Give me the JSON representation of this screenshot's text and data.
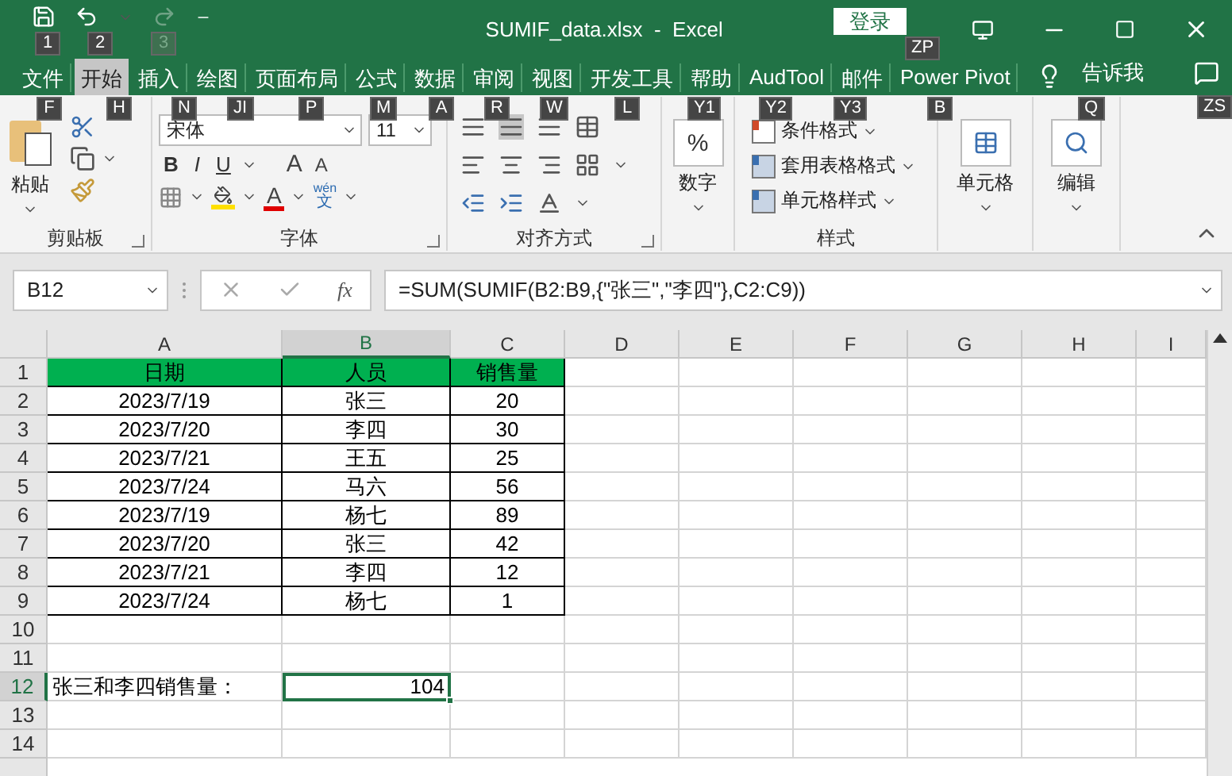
{
  "window": {
    "title": "SUMIF_data.xlsx  -  Excel",
    "login": "登录"
  },
  "tabs": [
    {
      "label": "文件",
      "selected": false
    },
    {
      "label": "开始",
      "selected": true
    },
    {
      "label": "插入",
      "selected": false
    },
    {
      "label": "绘图",
      "selected": false
    },
    {
      "label": "页面布局",
      "selected": false
    },
    {
      "label": "公式",
      "selected": false
    },
    {
      "label": "数据",
      "selected": false
    },
    {
      "label": "审阅",
      "selected": false
    },
    {
      "label": "视图",
      "selected": false
    },
    {
      "label": "开发工具",
      "selected": false
    },
    {
      "label": "帮助",
      "selected": false
    },
    {
      "label": "AudTool",
      "selected": false
    },
    {
      "label": "邮件",
      "selected": false
    },
    {
      "label": "Power Pivot",
      "selected": false
    }
  ],
  "tell_me": "告诉我",
  "keytips": [
    {
      "label": "1",
      "disabled": false
    },
    {
      "label": "2",
      "disabled": false
    },
    {
      "label": "3",
      "disabled": true
    },
    {
      "label": "ZP",
      "disabled": false
    },
    {
      "label": "F",
      "disabled": false
    },
    {
      "label": "H",
      "disabled": false
    },
    {
      "label": "N",
      "disabled": false
    },
    {
      "label": "JI",
      "disabled": false
    },
    {
      "label": "P",
      "disabled": false
    },
    {
      "label": "M",
      "disabled": false
    },
    {
      "label": "A",
      "disabled": false
    },
    {
      "label": "R",
      "disabled": false
    },
    {
      "label": "W",
      "disabled": false
    },
    {
      "label": "L",
      "disabled": false
    },
    {
      "label": "Y1",
      "disabled": false
    },
    {
      "label": "Y2",
      "disabled": false
    },
    {
      "label": "Y3",
      "disabled": false
    },
    {
      "label": "B",
      "disabled": false
    },
    {
      "label": "Q",
      "disabled": false
    },
    {
      "label": "ZS",
      "disabled": false
    }
  ],
  "ribbon": {
    "clipboard": {
      "paste": "粘贴",
      "label": "剪贴板"
    },
    "font": {
      "font_name": "宋体",
      "font_size": "11",
      "label": "字体",
      "format_buttons": [
        {
          "label": "B",
          "kind": "bold"
        },
        {
          "label": "I",
          "kind": "italic"
        },
        {
          "label": "U",
          "kind": "underline"
        }
      ],
      "grow": "A",
      "shrink": "A",
      "font_color": "A",
      "phonetic": [
        "wén",
        "文"
      ]
    },
    "alignment": {
      "label": "对齐方式"
    },
    "number": {
      "symbol": "%",
      "label": "数字"
    },
    "styles": {
      "items": [
        "条件格式",
        "套用表格格式",
        "单元格样式"
      ],
      "label": "样式"
    },
    "cells": {
      "label": "单元格"
    },
    "editing": {
      "label": "编辑"
    }
  },
  "formula_bar": {
    "name_box": "B12",
    "function_label": "fx",
    "formula": "=SUM(SUMIF(B2:B9,{\"张三\",\"李四\"},C2:C9))"
  },
  "sheet": {
    "columns": [
      {
        "label": "A",
        "selected": false
      },
      {
        "label": "B",
        "selected": true
      },
      {
        "label": "C",
        "selected": false
      },
      {
        "label": "D",
        "selected": false
      },
      {
        "label": "E",
        "selected": false
      },
      {
        "label": "F",
        "selected": false
      },
      {
        "label": "G",
        "selected": false
      },
      {
        "label": "H",
        "selected": false
      },
      {
        "label": "I",
        "selected": false
      }
    ],
    "rows": [
      {
        "number": "1",
        "kind": "header",
        "selected": false,
        "cells": [
          "日期",
          "人员",
          "销售量"
        ]
      },
      {
        "number": "2",
        "kind": "data",
        "selected": false,
        "cells": [
          "2023/7/19",
          "张三",
          "20"
        ]
      },
      {
        "number": "3",
        "kind": "data",
        "selected": false,
        "cells": [
          "2023/7/20",
          "李四",
          "30"
        ]
      },
      {
        "number": "4",
        "kind": "data",
        "selected": false,
        "cells": [
          "2023/7/21",
          "王五",
          "25"
        ]
      },
      {
        "number": "5",
        "kind": "data",
        "selected": false,
        "cells": [
          "2023/7/24",
          "马六",
          "56"
        ]
      },
      {
        "number": "6",
        "kind": "data",
        "selected": false,
        "cells": [
          "2023/7/19",
          "杨七",
          "89"
        ]
      },
      {
        "number": "7",
        "kind": "data",
        "selected": false,
        "cells": [
          "2023/7/20",
          "张三",
          "42"
        ]
      },
      {
        "number": "8",
        "kind": "data",
        "selected": false,
        "cells": [
          "2023/7/21",
          "李四",
          "12"
        ]
      },
      {
        "number": "9",
        "kind": "data",
        "selected": false,
        "cells": [
          "2023/7/24",
          "杨七",
          "1"
        ]
      },
      {
        "number": "10",
        "kind": "blank",
        "selected": false,
        "cells": []
      },
      {
        "number": "11",
        "kind": "blank",
        "selected": false,
        "cells": []
      },
      {
        "number": "12",
        "kind": "result",
        "selected": true,
        "cells": [
          "张三和李四销售量：",
          "104"
        ]
      },
      {
        "number": "13",
        "kind": "blank",
        "selected": false,
        "cells": []
      },
      {
        "number": "14",
        "kind": "blank",
        "selected": false,
        "cells": []
      }
    ]
  }
}
